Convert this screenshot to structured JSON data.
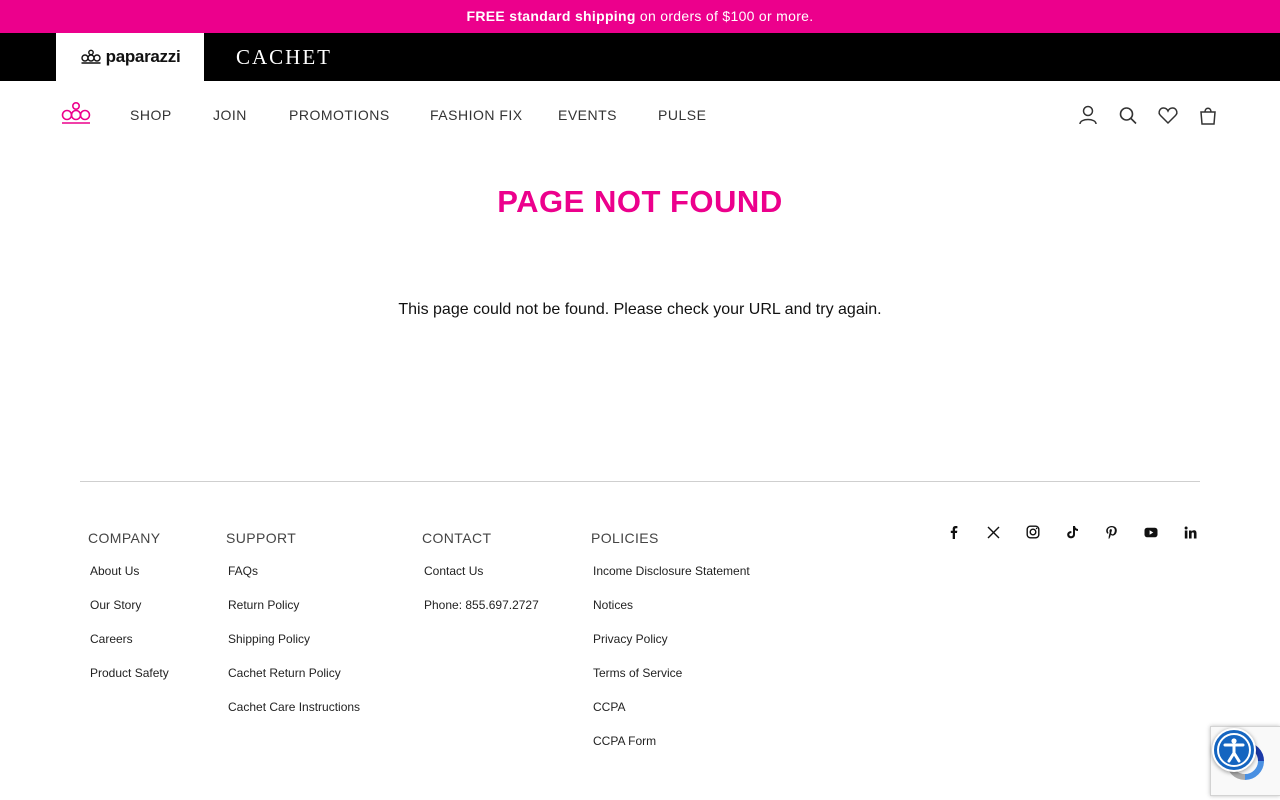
{
  "promo": {
    "bold": "FREE standard shipping",
    "rest": " on orders of $100 or more."
  },
  "brands": {
    "paparazzi": "paparazzi",
    "cachet": "CACHET"
  },
  "nav": {
    "items": [
      "SHOP",
      "JOIN",
      "PROMOTIONS",
      "FASHION FIX",
      "EVENTS",
      "PULSE"
    ]
  },
  "main": {
    "title": "PAGE NOT FOUND",
    "message": "This page could not be found. Please check your URL and try again."
  },
  "footer": {
    "columns": [
      {
        "heading": "COMPANY",
        "links": [
          "About Us",
          "Our Story",
          "Careers",
          "Product Safety"
        ]
      },
      {
        "heading": "SUPPORT",
        "links": [
          "FAQs",
          "Return Policy",
          "Shipping Policy",
          "Cachet Return Policy",
          "Cachet Care Instructions"
        ]
      },
      {
        "heading": "CONTACT",
        "links": [
          "Contact Us",
          "Phone: 855.697.2727"
        ]
      },
      {
        "heading": "POLICIES",
        "links": [
          "Income Disclosure Statement",
          "Notices",
          "Privacy Policy",
          "Terms of Service",
          "CCPA",
          "CCPA Form"
        ]
      }
    ],
    "social": [
      "facebook-icon",
      "x-icon",
      "instagram-icon",
      "tiktok-icon",
      "pinterest-icon",
      "youtube-icon",
      "linkedin-icon"
    ]
  },
  "colors": {
    "accent": "#ec008c",
    "brandbar": "#000000",
    "a11y": "#1565c0"
  }
}
